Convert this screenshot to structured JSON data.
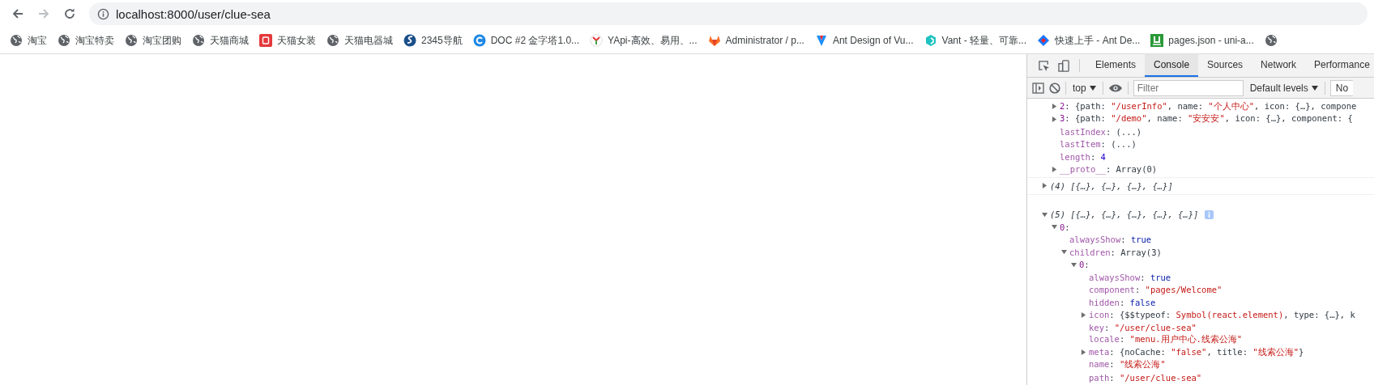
{
  "browser": {
    "nav": [
      {
        "kind": "back",
        "disabled": false
      },
      {
        "kind": "forward",
        "disabled": true
      },
      {
        "kind": "reload",
        "disabled": false
      }
    ],
    "url": "localhost:8000/user/clue-sea"
  },
  "bookmarks": [
    {
      "kind": "globe",
      "label": "淘宝"
    },
    {
      "kind": "globe",
      "label": "淘宝特卖"
    },
    {
      "kind": "globe",
      "label": "淘宝团购"
    },
    {
      "kind": "globe",
      "label": "天猫商城"
    },
    {
      "kind": "red-square",
      "label": "天猫女装"
    },
    {
      "kind": "globe",
      "label": "天猫电器城"
    },
    {
      "kind": "swirl",
      "label": "2345导航"
    },
    {
      "kind": "ring",
      "label": "DOC #2 金字塔1.0..."
    },
    {
      "kind": "y-mark",
      "label": "YApi-高效、易用、..."
    },
    {
      "kind": "fox",
      "label": "Administrator / p..."
    },
    {
      "kind": "v-mark",
      "label": "Ant Design of Vu..."
    },
    {
      "kind": "hex",
      "label": "Vant - 轻量、可靠..."
    },
    {
      "kind": "diamond",
      "label": "快速上手 - Ant De..."
    },
    {
      "kind": "green-square",
      "label": "pages.json - uni-a..."
    },
    {
      "kind": "globe"
    }
  ],
  "devtools": {
    "tabs": [
      {
        "label": "Elements",
        "selected": false
      },
      {
        "label": "Console",
        "selected": true
      },
      {
        "label": "Sources",
        "selected": false
      },
      {
        "label": "Network",
        "selected": false
      },
      {
        "label": "Performance",
        "selected": false
      }
    ],
    "context": "top",
    "filter": {
      "placeholder": "Filter"
    },
    "levels": "Default levels",
    "cut_button": "No"
  },
  "console": [
    {
      "kind": "continued",
      "entries": [
        {
          "expanded": false,
          "tokens": [
            {
              "kind": "index",
              "text": "2"
            },
            {
              "kind": "plain",
              "text": ": {path: "
            },
            {
              "kind": "string",
              "text": "\"/userInfo\""
            },
            {
              "kind": "plain",
              "text": ", name: "
            },
            {
              "kind": "string",
              "text": "\"个人中心\""
            },
            {
              "kind": "plain",
              "text": ", icon: {…}, compone"
            }
          ]
        },
        {
          "expanded": false,
          "tokens": [
            {
              "kind": "index",
              "text": "3"
            },
            {
              "kind": "plain",
              "text": ": {path: "
            },
            {
              "kind": "string",
              "text": "\"/demo\""
            },
            {
              "kind": "plain",
              "text": ", name: "
            },
            {
              "kind": "string",
              "text": "\"安安安\""
            },
            {
              "kind": "plain",
              "text": ", icon: {…}, component: {"
            }
          ]
        },
        {
          "tokens": [
            {
              "kind": "key",
              "text": "lastIndex"
            },
            {
              "kind": "plain",
              "text": ": (...)"
            }
          ]
        },
        {
          "tokens": [
            {
              "kind": "key",
              "text": "lastItem"
            },
            {
              "kind": "plain",
              "text": ": (...)"
            }
          ]
        },
        {
          "tokens": [
            {
              "kind": "key",
              "text": "length"
            },
            {
              "kind": "plain",
              "text": ": "
            },
            {
              "kind": "number",
              "text": "4"
            }
          ]
        },
        {
          "expanded": false,
          "tokens": [
            {
              "kind": "key",
              "text": "__proto__"
            },
            {
              "kind": "plain",
              "text": ": Array(0)"
            }
          ]
        }
      ]
    },
    {
      "kind": "log",
      "entries": [
        {
          "expanded": false,
          "tokens": [
            {
              "kind": "preview",
              "text": "(4) [{…}, {…}, {…}, {…}]"
            }
          ]
        }
      ]
    },
    {
      "kind": "log",
      "entries": [
        {
          "expanded": true,
          "info_badge": true,
          "tokens": [
            {
              "kind": "preview",
              "text": "(5) [{…}, {…}, {…}, {…}, {…}]"
            }
          ],
          "children": [
            {
              "expanded": true,
              "tokens": [
                {
                  "kind": "index",
                  "text": "0"
                },
                {
                  "kind": "plain",
                  "text": ":"
                }
              ],
              "children": [
                {
                  "tokens": [
                    {
                      "kind": "key",
                      "text": "alwaysShow"
                    },
                    {
                      "kind": "plain",
                      "text": ": "
                    },
                    {
                      "kind": "keyword",
                      "text": "true"
                    }
                  ]
                },
                {
                  "expanded": true,
                  "tokens": [
                    {
                      "kind": "key",
                      "text": "children"
                    },
                    {
                      "kind": "plain",
                      "text": ": Array(3)"
                    }
                  ],
                  "children": [
                    {
                      "expanded": true,
                      "tokens": [
                        {
                          "kind": "index",
                          "text": "0"
                        },
                        {
                          "kind": "plain",
                          "text": ":"
                        }
                      ],
                      "children": [
                        {
                          "tokens": [
                            {
                              "kind": "key",
                              "text": "alwaysShow"
                            },
                            {
                              "kind": "plain",
                              "text": ": "
                            },
                            {
                              "kind": "keyword",
                              "text": "true"
                            }
                          ]
                        },
                        {
                          "tokens": [
                            {
                              "kind": "key",
                              "text": "component"
                            },
                            {
                              "kind": "plain",
                              "text": ": "
                            },
                            {
                              "kind": "string",
                              "text": "\"pages/Welcome\""
                            }
                          ]
                        },
                        {
                          "tokens": [
                            {
                              "kind": "key",
                              "text": "hidden"
                            },
                            {
                              "kind": "plain",
                              "text": ": "
                            },
                            {
                              "kind": "keyword",
                              "text": "false"
                            }
                          ]
                        },
                        {
                          "expanded": false,
                          "tokens": [
                            {
                              "kind": "key",
                              "text": "icon"
                            },
                            {
                              "kind": "plain",
                              "text": ": {$$typeof: "
                            },
                            {
                              "kind": "string",
                              "text": "Symbol(react.element)"
                            },
                            {
                              "kind": "plain",
                              "text": ", type: {…}, k"
                            }
                          ]
                        },
                        {
                          "tokens": [
                            {
                              "kind": "key",
                              "text": "key"
                            },
                            {
                              "kind": "plain",
                              "text": ": "
                            },
                            {
                              "kind": "string",
                              "text": "\"/user/clue-sea\""
                            }
                          ]
                        },
                        {
                          "tokens": [
                            {
                              "kind": "key",
                              "text": "locale"
                            },
                            {
                              "kind": "plain",
                              "text": ": "
                            },
                            {
                              "kind": "string",
                              "text": "\"menu.用户中心.线索公海\""
                            }
                          ]
                        },
                        {
                          "expanded": false,
                          "tokens": [
                            {
                              "kind": "key",
                              "text": "meta"
                            },
                            {
                              "kind": "plain",
                              "text": ": {noCache: "
                            },
                            {
                              "kind": "string",
                              "text": "\"false\""
                            },
                            {
                              "kind": "plain",
                              "text": ", title: "
                            },
                            {
                              "kind": "string",
                              "text": "\"线索公海\""
                            },
                            {
                              "kind": "plain",
                              "text": "}"
                            }
                          ]
                        },
                        {
                          "tokens": [
                            {
                              "kind": "key",
                              "text": "name"
                            },
                            {
                              "kind": "plain",
                              "text": ": "
                            },
                            {
                              "kind": "string",
                              "text": "\"线索公海\""
                            }
                          ]
                        },
                        {
                          "tokens": [
                            {
                              "kind": "key",
                              "text": "path"
                            },
                            {
                              "kind": "plain",
                              "text": ": "
                            },
                            {
                              "kind": "string",
                              "text": "\"/user/clue-sea\""
                            }
                          ]
                        }
                      ]
                    }
                  ]
                }
              ]
            }
          ]
        }
      ]
    }
  ]
}
